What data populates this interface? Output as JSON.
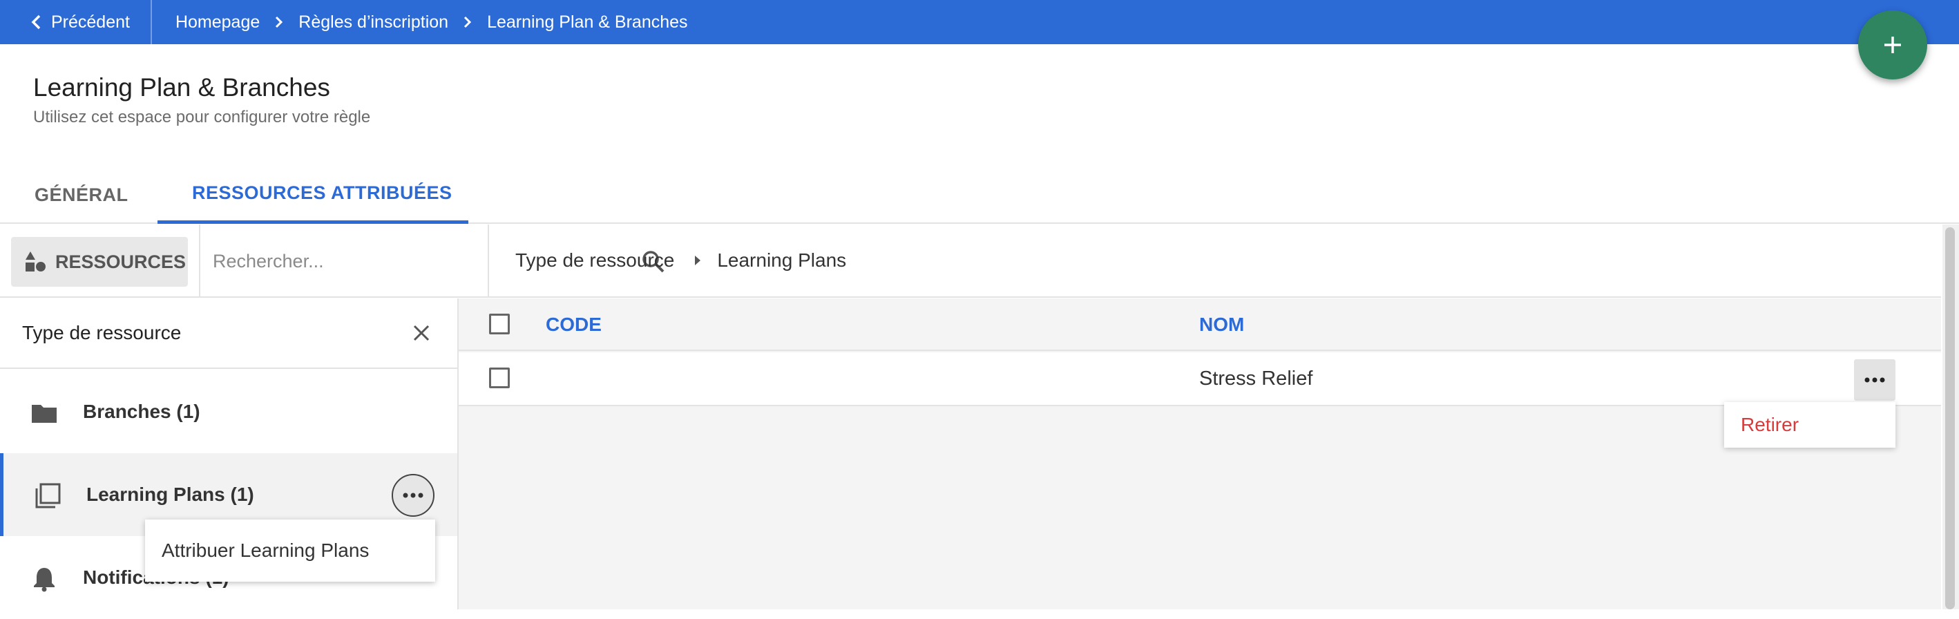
{
  "topbar": {
    "back_label": "Précédent",
    "breadcrumbs": [
      "Homepage",
      "Règles d’inscription",
      "Learning Plan & Branches"
    ],
    "color": "#2c6ad6"
  },
  "fab": {
    "icon": "plus-icon",
    "color": "#2f8560"
  },
  "header": {
    "title": "Learning Plan & Branches",
    "subtitle": "Utilisez cet espace pour configurer votre règle"
  },
  "tabs": [
    {
      "label": "GÉNÉRAL",
      "active": false
    },
    {
      "label": "RESSOURCES ATTRIBUÉES",
      "active": true
    }
  ],
  "toolbar": {
    "resources_button": "RESSOURCES",
    "search_placeholder": "Rechercher...",
    "path": [
      "Type de ressource",
      "Learning Plans"
    ]
  },
  "left_panel": {
    "title": "Type de ressource",
    "items": [
      {
        "label": "Branches (1)",
        "icon": "folder-icon"
      },
      {
        "label": "Learning Plans (1)",
        "icon": "learning-plan-icon",
        "selected": true
      },
      {
        "label": "Notifications (1)",
        "icon": "bell-icon"
      }
    ],
    "context_menu": "Attribuer Learning Plans"
  },
  "table": {
    "columns": [
      "CODE",
      "NOM"
    ],
    "rows": [
      {
        "code": "",
        "name": "Stress Relief"
      }
    ],
    "row_menu": "Retirer"
  },
  "colors": {
    "accent": "#2c6ad6",
    "danger": "#d93b3b"
  }
}
